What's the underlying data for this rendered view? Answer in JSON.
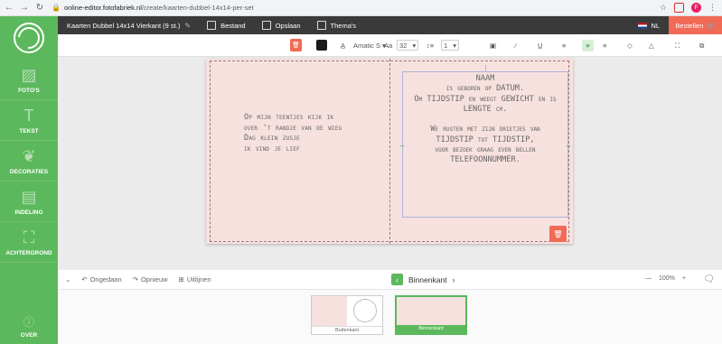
{
  "browser": {
    "url_host": "online-editor.fotofabriek.nl",
    "url_path": "/create/kaarten-dubbel-14x14-per-set",
    "profile_initial": "F"
  },
  "sidebar": {
    "items": [
      {
        "label": "FOTO'S",
        "icon": "photos-icon"
      },
      {
        "label": "TEKST",
        "icon": "text-icon"
      },
      {
        "label": "DECORATIES",
        "icon": "decorations-icon"
      },
      {
        "label": "INDELING",
        "icon": "layout-icon"
      },
      {
        "label": "ACHTERGROND",
        "icon": "background-icon"
      }
    ],
    "bottom_label": "OVER"
  },
  "header": {
    "doc_title": "Kaarten Dubbel 14x14 Vierkant (9 st.)",
    "bestand": "Bestand",
    "opslaan": "Opslaan",
    "themas": "Thema's",
    "language": "NL",
    "order": "Bestellen"
  },
  "toolbar": {
    "font_name": "Amatic S",
    "font_size": "32",
    "line_spacing": "1",
    "text_color": "#1a1a1a"
  },
  "card": {
    "left_lines": [
      "Op mijn teentjes kijk ik",
      "over 't randje van de wieg",
      "Dag klein zusje",
      "ik vind je lief"
    ],
    "right_lines": [
      "NAAM",
      "is geboren op DATUM.",
      "Om TIJDSTIP en weegt GEWICHT en is",
      "LENGTE cm.",
      "",
      "We rusten met zijn drietjes van",
      "TIJDSTIP tot TIJDSTIP,",
      "voor bezoek graag even bellen",
      "TELEFOONNUMMER."
    ]
  },
  "actionbar": {
    "undo": "Ongedaan",
    "redo": "Opnieuw",
    "align": "Uitlijnen",
    "page_label": "Binnenkant",
    "zoom": "100%"
  },
  "thumbnails": [
    {
      "label": "Buitenkant",
      "active": false
    },
    {
      "label": "Binnenkant",
      "active": true
    }
  ],
  "colors": {
    "accent_green": "#5cb85c",
    "order_red": "#f06a55",
    "header_dark": "#3a3a3a",
    "card_pink": "#f7e1df"
  }
}
